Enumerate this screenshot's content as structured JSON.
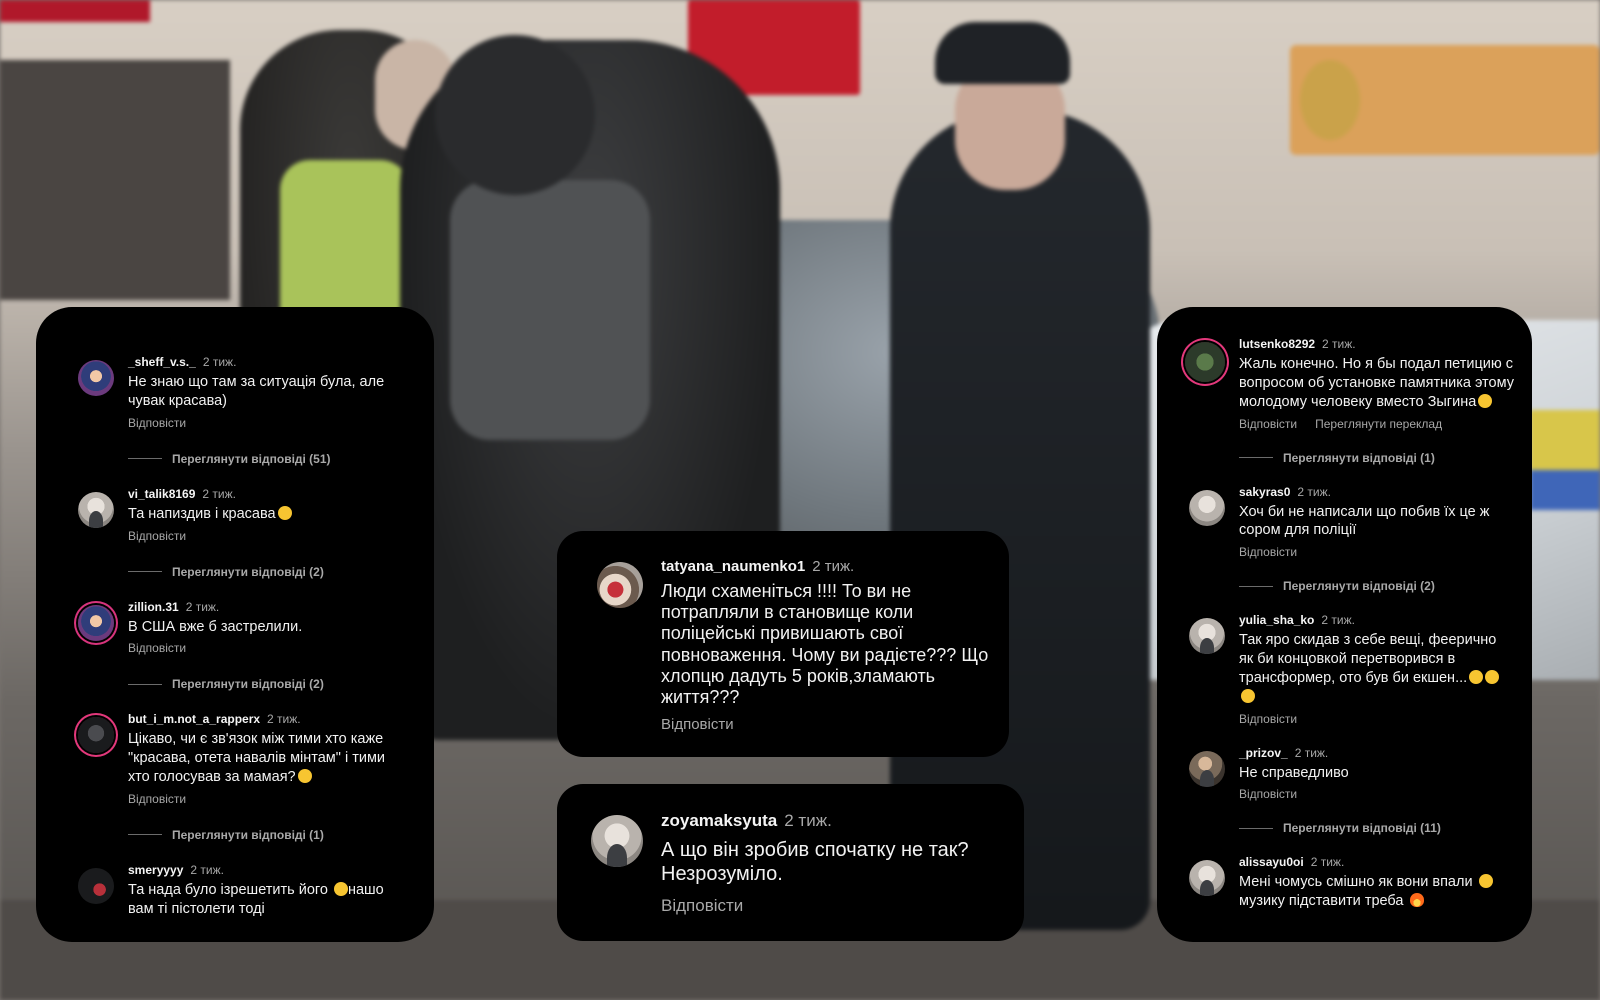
{
  "left_panel": {
    "comments": [
      {
        "user": "_sheff_v.s._",
        "time": "2 тиж.",
        "text": "Не знаю що там за ситуація була,  але чувак красава)",
        "reply": "Відповісти",
        "view_replies": "Переглянути відповіді (51)"
      },
      {
        "user": "vi_talik8169",
        "time": "2 тиж.",
        "text": "Та напиздив і красава",
        "reply": "Відповісти",
        "view_replies": "Переглянути відповіді (2)"
      },
      {
        "user": "zillion.31",
        "time": "2 тиж.",
        "text": "В США вже б застрелили.",
        "reply": "Відповісти",
        "view_replies": "Переглянути відповіді (2)"
      },
      {
        "user": "but_i_m.not_a_rapperx",
        "time": "2 тиж.",
        "text": "Цікаво, чи є зв'язок між тими хто каже \"красава, отета навалів мінтам\"  і тими хто голосував за мамая?",
        "reply": "Відповісти",
        "view_replies": "Переглянути відповіді (1)"
      },
      {
        "user": "smeryyyy",
        "time": "2 тиж.",
        "text": "Та нада було ізрешетить його",
        "text2": "нашо вам ті пістолети тоді"
      }
    ]
  },
  "middle_panels": [
    {
      "user": "tatyana_naumenko1",
      "time": "2 тиж.",
      "text": "Люди схаменіться !!!! То ви не потрапляли в становище коли поліцейські привишають свої повноваження. Чому ви радієте??? Що хлопцю дадуть 5 років,зламають життя???",
      "reply": "Відповісти"
    },
    {
      "user": "zoyamaksyuta",
      "time": "2 тиж.",
      "text": "А що він зробив спочатку не так? Незрозуміло.",
      "reply": "Відповісти"
    }
  ],
  "right_panel": {
    "comments": [
      {
        "user": "lutsenko8292",
        "time": "2 тиж.",
        "text": "Жаль конечно. Но я бы подал петицию с вопросом об установке памятника этому молодому человеку вместо Зыгина",
        "reply": "Відповісти",
        "translate": "Переглянути переклад",
        "view_replies": "Переглянути відповіді (1)"
      },
      {
        "user": "sakyras0",
        "time": "2 тиж.",
        "text": "Хоч би не написали що побив їх це ж сором для поліції",
        "reply": "Відповісти",
        "view_replies": "Переглянути відповіді (2)"
      },
      {
        "user": "yulia_sha_ko",
        "time": "2 тиж.",
        "text": "Так яро скидав з себе вещі, феерично як би концовкой перетворився в трансформер, ото був би екшен...",
        "reply": "Відповісти"
      },
      {
        "user": "_prizov_",
        "time": "2 тиж.",
        "text": "Не справедливо",
        "reply": "Відповісти",
        "view_replies": "Переглянути відповіді (11)"
      },
      {
        "user": "alissayu0oi",
        "time": "2 тиж.",
        "text": "Мені чомусь смішно як вони впали",
        "text2": "музику підставити треба"
      }
    ]
  },
  "colors": {
    "panel_bg": "#000000",
    "username": "#f5f5f5",
    "muted": "#a8a8a8",
    "story_ring": "#e3387b"
  },
  "icons": [
    "laughing-emoji-icon",
    "exploding-head-emoji-icon",
    "fire-emoji-icon",
    "rolling-laughing-emoji-icon"
  ]
}
